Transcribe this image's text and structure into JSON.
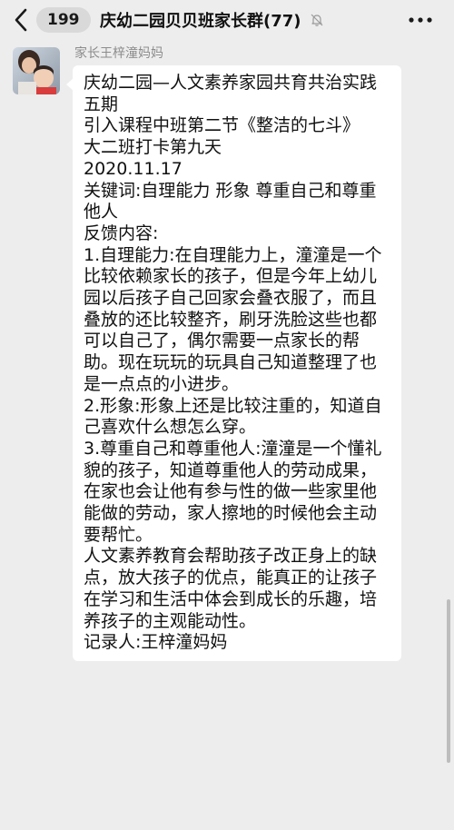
{
  "header": {
    "back_badge": "199",
    "title": "庆幼二园贝贝班家长群(77)",
    "icons": {
      "back": "chevron-left-icon",
      "mute": "bell-muted-icon",
      "more": "more-icon"
    }
  },
  "message": {
    "sender": "家长王梓潼妈妈",
    "avatar": "avatar",
    "lines": [
      "庆幼二园—人文素养家园共育共治实践五期",
      "引入课程中班第二节《整洁的七斗》",
      "大二班打卡第九天",
      "2020.11.17",
      "关键词:自理能力 形象 尊重自己和尊重他人",
      "反馈内容:",
      "1.自理能力:在自理能力上，潼潼是一个比较依赖家长的孩子，但是今年上幼儿园以后孩子自己回家会叠衣服了，而且叠放的还比较整齐，刷牙洗脸这些也都可以自己了，偶尔需要一点家长的帮助。现在玩玩的玩具自己知道整理了也是一点点的小进步。",
      "2.形象:形象上还是比较注重的，知道自己喜欢什么想怎么穿。",
      "3.尊重自己和尊重他人:潼潼是一个懂礼貌的孩子，知道尊重他人的劳动成果，在家也会让他有参与性的做一些家里他能做的劳动，家人擦地的时候他会主动要帮忙。",
      "人文素养教育会帮助孩子改正身上的缺点，放大孩子的优点，能真正的让孩子在学习和生活中体会到成长的乐趣，培养孩子的主观能动性。",
      "记录人:王梓潼妈妈"
    ]
  }
}
